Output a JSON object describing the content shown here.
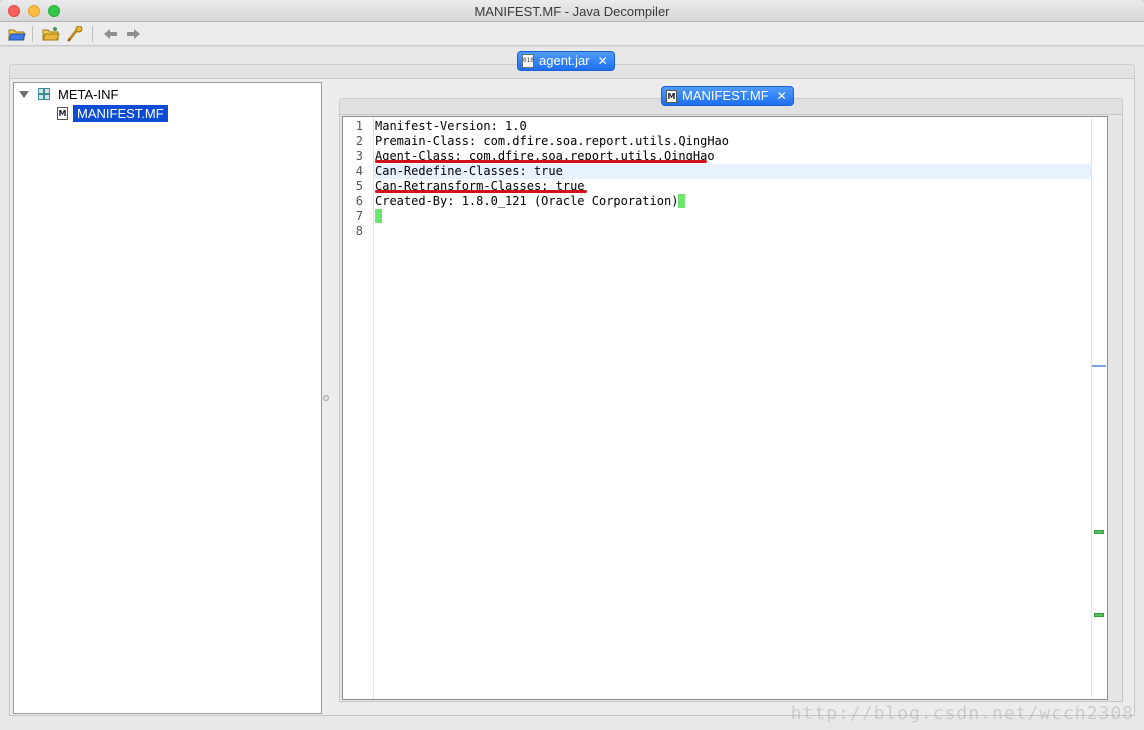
{
  "window": {
    "title": "MANIFEST.MF - Java Decompiler"
  },
  "toolbar": {
    "buttons": [
      {
        "icon": "open-file-icon"
      },
      {
        "icon": "open-folder-icon"
      },
      {
        "icon": "search-icon"
      },
      {
        "icon": "back-arrow-icon"
      },
      {
        "icon": "forward-arrow-icon"
      }
    ]
  },
  "outer_tab": {
    "label": "agent.jar",
    "icon_text": "010"
  },
  "tree": {
    "root": {
      "label": "META-INF"
    },
    "child": {
      "label": "MANIFEST.MF",
      "icon_text": "M"
    }
  },
  "editor_tab": {
    "label": "MANIFEST.MF",
    "icon_text": "M"
  },
  "editor": {
    "lines": [
      {
        "no": "1",
        "text": "Manifest-Version: 1.0"
      },
      {
        "no": "2",
        "text": "Premain-Class: com.dfire.soa.report.utils.QingHao"
      },
      {
        "no": "3",
        "text": "Agent-Class: com.dfire.soa.report.utils.QingHao"
      },
      {
        "no": "4",
        "text": "Can-Redefine-Classes: true"
      },
      {
        "no": "5",
        "text": "Can-Retransform-Classes: true"
      },
      {
        "no": "6",
        "text": "Created-By: 1.8.0_121 (Oracle Corporation)"
      },
      {
        "no": "7",
        "text": ""
      },
      {
        "no": "8",
        "text": ""
      }
    ]
  },
  "watermark": "http://blog.csdn.net/wcch2308",
  "colors": {
    "tab_accent": "#1d6ff2",
    "selection": "#0d4cd4",
    "underline": "#d0101a",
    "caret": "#6fe36f"
  }
}
